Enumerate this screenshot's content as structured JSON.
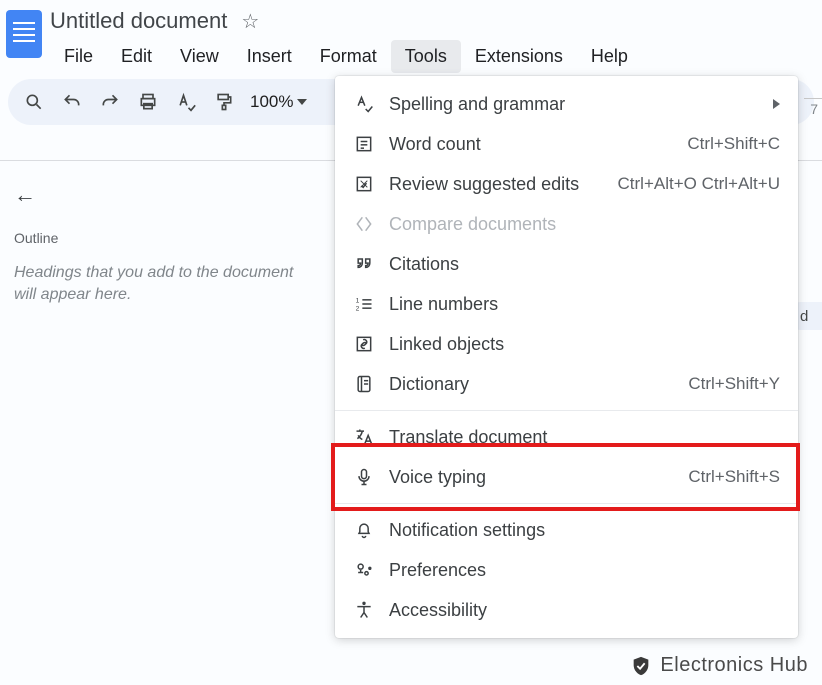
{
  "header": {
    "title": "Untitled document",
    "menus": [
      "File",
      "Edit",
      "View",
      "Insert",
      "Format",
      "Tools",
      "Extensions",
      "Help"
    ],
    "active_menu": "Tools"
  },
  "toolbar": {
    "zoom": "100%"
  },
  "ruler": {
    "mark": "7"
  },
  "sidebar": {
    "outline_label": "Outline",
    "outline_hint": "Headings that you add to the document will appear here."
  },
  "right_stub": "d",
  "tools_menu": {
    "items": [
      {
        "id": "spelling",
        "label": "Spelling and grammar",
        "shortcut": "",
        "submenu": true,
        "disabled": false,
        "icon": "spellcheck-icon"
      },
      {
        "id": "wordcount",
        "label": "Word count",
        "shortcut": "Ctrl+Shift+C",
        "submenu": false,
        "disabled": false,
        "icon": "wordcount-icon"
      },
      {
        "id": "review",
        "label": "Review suggested edits",
        "shortcut": "Ctrl+Alt+O Ctrl+Alt+U",
        "submenu": false,
        "disabled": false,
        "icon": "review-icon"
      },
      {
        "id": "compare",
        "label": "Compare documents",
        "shortcut": "",
        "submenu": false,
        "disabled": true,
        "icon": "compare-icon"
      },
      {
        "id": "citations",
        "label": "Citations",
        "shortcut": "",
        "submenu": false,
        "disabled": false,
        "icon": "quote-icon"
      },
      {
        "id": "linenumbers",
        "label": "Line numbers",
        "shortcut": "",
        "submenu": false,
        "disabled": false,
        "icon": "linenumbers-icon"
      },
      {
        "id": "linked",
        "label": "Linked objects",
        "shortcut": "",
        "submenu": false,
        "disabled": false,
        "icon": "link-icon"
      },
      {
        "id": "dictionary",
        "label": "Dictionary",
        "shortcut": "Ctrl+Shift+Y",
        "submenu": false,
        "disabled": false,
        "icon": "dictionary-icon"
      },
      {
        "sep": true
      },
      {
        "id": "translate",
        "label": "Translate document",
        "shortcut": "",
        "submenu": false,
        "disabled": false,
        "icon": "translate-icon"
      },
      {
        "id": "voice",
        "label": "Voice typing",
        "shortcut": "Ctrl+Shift+S",
        "submenu": false,
        "disabled": false,
        "icon": "mic-icon",
        "highlighted": true
      },
      {
        "sep": true
      },
      {
        "id": "notif",
        "label": "Notification settings",
        "shortcut": "",
        "submenu": false,
        "disabled": false,
        "icon": "bell-icon"
      },
      {
        "id": "prefs",
        "label": "Preferences",
        "shortcut": "",
        "submenu": false,
        "disabled": false,
        "icon": "prefs-icon"
      },
      {
        "id": "a11y",
        "label": "Accessibility",
        "shortcut": "",
        "submenu": false,
        "disabled": false,
        "icon": "accessibility-icon"
      }
    ]
  },
  "watermark": {
    "text1": "Electronics",
    "text2": "Hub"
  }
}
